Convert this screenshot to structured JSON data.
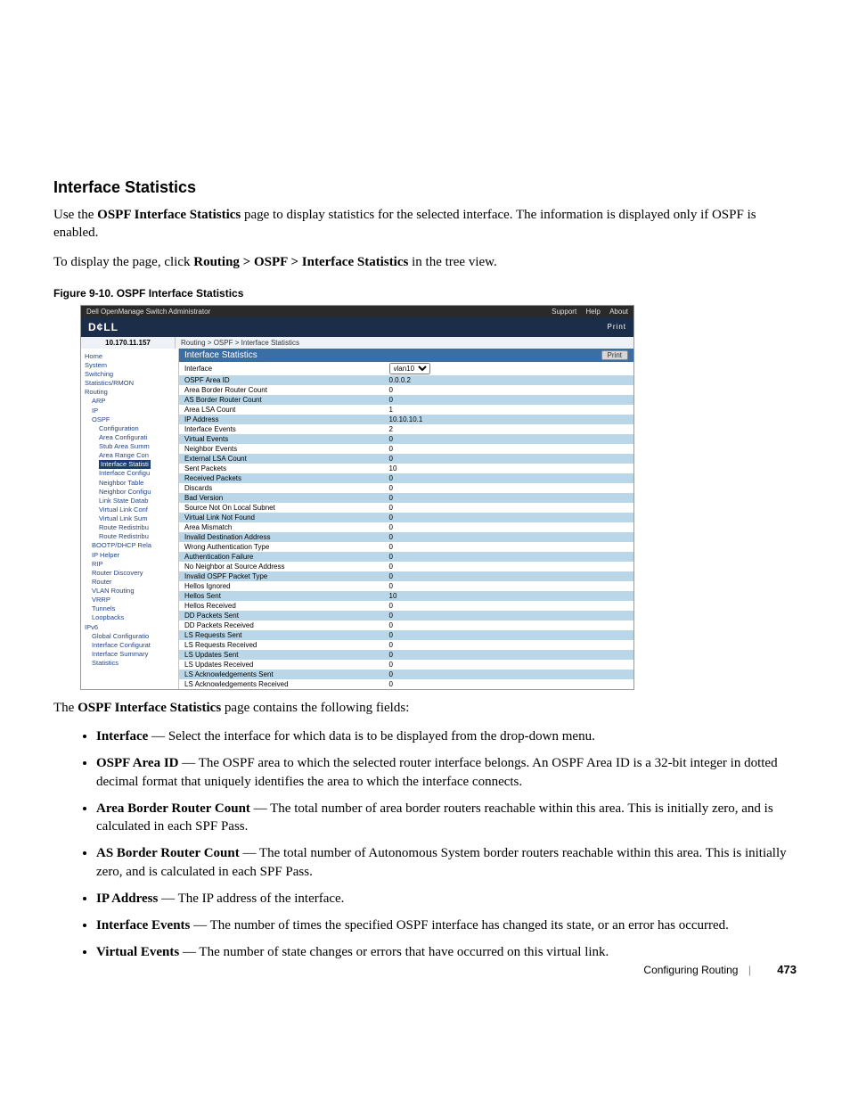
{
  "heading": "Interface Statistics",
  "para1a": "Use the ",
  "para1b": "OSPF Interface Statistics",
  "para1c": " page to display statistics for the selected interface. The information is displayed only if OSPF is enabled.",
  "para2a": "To display the page, click ",
  "para2b": "Routing > OSPF > Interface Statistics",
  "para2c": " in the tree view.",
  "figcap": "Figure 9-10.    OSPF Interface Statistics",
  "shot": {
    "title": "Dell OpenManage Switch Administrator",
    "links": {
      "support": "Support",
      "help": "Help",
      "about": "About"
    },
    "brand": "D¢LL",
    "printlink": "Print",
    "ip": "10.170.11.157",
    "breadcrumb": "Routing > OSPF > Interface Statistics",
    "panel_title": "Interface Statistics",
    "print_btn": "Print",
    "nav": [
      {
        "lvl": 1,
        "label": "Home"
      },
      {
        "lvl": 1,
        "label": "System"
      },
      {
        "lvl": 1,
        "label": "Switching"
      },
      {
        "lvl": 1,
        "label": "Statistics/RMON"
      },
      {
        "lvl": 1,
        "label": "Routing"
      },
      {
        "lvl": 2,
        "label": "ARP"
      },
      {
        "lvl": 2,
        "label": "IP"
      },
      {
        "lvl": 2,
        "label": "OSPF"
      },
      {
        "lvl": 3,
        "label": "Configuration"
      },
      {
        "lvl": 3,
        "label": "Area Configurati"
      },
      {
        "lvl": 3,
        "label": "Stub Area Summ"
      },
      {
        "lvl": 3,
        "label": "Area Range Con"
      },
      {
        "lvl": 3,
        "label": "Interface Statisti",
        "hl": true
      },
      {
        "lvl": 3,
        "label": "Interface Configu"
      },
      {
        "lvl": 3,
        "label": "Neighbor Table"
      },
      {
        "lvl": 3,
        "label": "Neighbor Configu"
      },
      {
        "lvl": 3,
        "label": "Link State Datab"
      },
      {
        "lvl": 3,
        "label": "Virtual Link Conf"
      },
      {
        "lvl": 3,
        "label": "Virtual Link Sum"
      },
      {
        "lvl": 3,
        "label": "Route Redistribu"
      },
      {
        "lvl": 3,
        "label": "Route Redistribu"
      },
      {
        "lvl": 2,
        "label": "BOOTP/DHCP Rela"
      },
      {
        "lvl": 2,
        "label": "IP Helper"
      },
      {
        "lvl": 2,
        "label": "RIP"
      },
      {
        "lvl": 2,
        "label": "Router Discovery"
      },
      {
        "lvl": 2,
        "label": "Router"
      },
      {
        "lvl": 2,
        "label": "VLAN Routing"
      },
      {
        "lvl": 2,
        "label": "VRRP"
      },
      {
        "lvl": 2,
        "label": "Tunnels"
      },
      {
        "lvl": 2,
        "label": "Loopbacks"
      },
      {
        "lvl": 1,
        "label": "IPv6"
      },
      {
        "lvl": 2,
        "label": "Global Configuratio"
      },
      {
        "lvl": 2,
        "label": "Interface Configurat"
      },
      {
        "lvl": 2,
        "label": "Interface Summary"
      },
      {
        "lvl": 2,
        "label": "Statistics"
      }
    ],
    "iface_selected": "vlan10",
    "rows": [
      {
        "label": "Interface",
        "value": "__select__"
      },
      {
        "label": "OSPF Area ID",
        "value": "0.0.0.2"
      },
      {
        "label": "Area Border Router Count",
        "value": "0"
      },
      {
        "label": "AS Border Router Count",
        "value": "0"
      },
      {
        "label": "Area LSA Count",
        "value": "1"
      },
      {
        "label": "IP Address",
        "value": "10.10.10.1"
      },
      {
        "label": "Interface Events",
        "value": "2"
      },
      {
        "label": "Virtual Events",
        "value": "0"
      },
      {
        "label": "Neighbor Events",
        "value": "0"
      },
      {
        "label": "External LSA Count",
        "value": "0"
      },
      {
        "label": "Sent Packets",
        "value": "10"
      },
      {
        "label": "Received Packets",
        "value": "0"
      },
      {
        "label": "Discards",
        "value": "0"
      },
      {
        "label": "Bad Version",
        "value": "0"
      },
      {
        "label": "Source Not On Local Subnet",
        "value": "0"
      },
      {
        "label": "Virtual Link Not Found",
        "value": "0"
      },
      {
        "label": "Area Mismatch",
        "value": "0"
      },
      {
        "label": "Invalid Destination Address",
        "value": "0"
      },
      {
        "label": "Wrong Authentication Type",
        "value": "0"
      },
      {
        "label": "Authentication Failure",
        "value": "0"
      },
      {
        "label": "No Neighbor at Source Address",
        "value": "0"
      },
      {
        "label": "Invalid OSPF Packet Type",
        "value": "0"
      },
      {
        "label": "Hellos Ignored",
        "value": "0"
      },
      {
        "label": "Hellos Sent",
        "value": "10"
      },
      {
        "label": "Hellos Received",
        "value": "0"
      },
      {
        "label": "DD Packets Sent",
        "value": "0"
      },
      {
        "label": "DD Packets Received",
        "value": "0"
      },
      {
        "label": "LS Requests Sent",
        "value": "0"
      },
      {
        "label": "LS Requests Received",
        "value": "0"
      },
      {
        "label": "LS Updates Sent",
        "value": "0"
      },
      {
        "label": "LS Updates Received",
        "value": "0"
      },
      {
        "label": "LS Acknowledgements Sent",
        "value": "0"
      },
      {
        "label": "LS Acknowledgements Received",
        "value": "0"
      }
    ]
  },
  "after_shot": "The OSPF Interface Statistics page contains the following fields:",
  "after_shot_bold": "OSPF Interface Statistics",
  "fields": [
    {
      "term": "Interface",
      "desc": " — Select the interface for which data is to be displayed from the drop-down menu."
    },
    {
      "term": "OSPF Area ID",
      "desc": " — The OSPF area to which the selected router interface belongs. An OSPF Area ID is a 32-bit integer in dotted decimal format that uniquely identifies the area to which the interface connects."
    },
    {
      "term": "Area Border Router Count",
      "desc": " — The total number of area border routers reachable within this area. This is initially zero, and is calculated in each SPF Pass."
    },
    {
      "term": "AS Border Router Count",
      "desc": " — The total number of Autonomous System border routers reachable within this area. This is initially zero, and is calculated in each SPF Pass."
    },
    {
      "term": "IP Address",
      "desc": " — The IP address of the interface."
    },
    {
      "term": "Interface Events",
      "desc": " — The number of times the specified OSPF interface has changed its state, or an error has occurred."
    },
    {
      "term": "Virtual Events",
      "desc": " — The number of state changes or errors that have occurred on this virtual link."
    }
  ],
  "footer": {
    "section": "Configuring Routing",
    "page": "473"
  }
}
